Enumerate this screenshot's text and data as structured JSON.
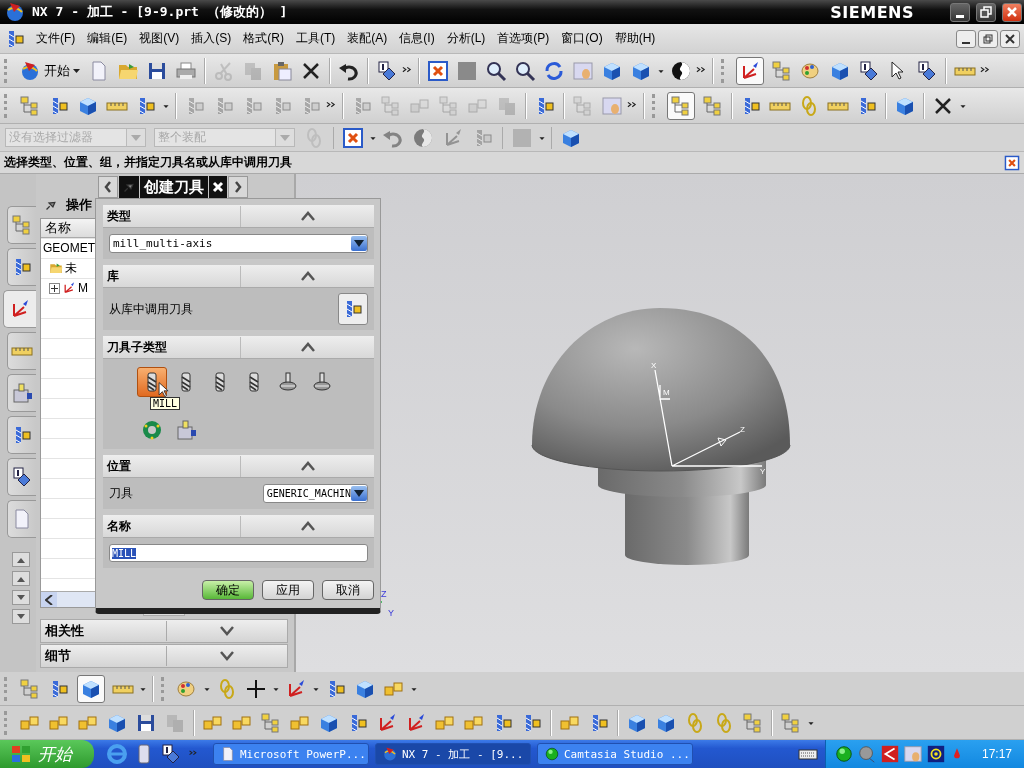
{
  "window": {
    "title": "NX 7 - 加工 - [9-9.prt （修改的） ]",
    "brand": "SIEMENS"
  },
  "menu": [
    "文件(F)",
    "编辑(E)",
    "视图(V)",
    "插入(S)",
    "格式(R)",
    "工具(T)",
    "装配(A)",
    "信息(I)",
    "分析(L)",
    "首选项(P)",
    "窗口(O)",
    "帮助(H)"
  ],
  "start_button": "开始",
  "filters": [
    {
      "value": "没有选择过滤器",
      "disabled": true
    },
    {
      "value": "整个装配",
      "disabled": true
    }
  ],
  "cue_line": "选择类型、位置、组，并指定刀具名或从库中调用刀具",
  "resource_tabs": [
    {
      "selected": false
    },
    {
      "selected": false
    },
    {
      "selected": true
    },
    {
      "selected": false
    },
    {
      "selected": false
    },
    {
      "selected": false
    },
    {
      "selected": false
    },
    {
      "selected": false
    }
  ],
  "navigator": {
    "title": "操作",
    "columns": [
      "名称"
    ],
    "tree": [
      {
        "label": "GEOMET",
        "children": [
          {
            "label": "未"
          },
          {
            "label": "M",
            "expanded": false
          }
        ]
      }
    ],
    "panels": [
      {
        "label": "相关性",
        "expanded": false
      },
      {
        "label": "细节",
        "expanded": false
      }
    ]
  },
  "dialog": {
    "title": "创建刀具",
    "sections": [
      {
        "kind": "dropdown",
        "title": "类型",
        "expanded": true,
        "value": "mill_multi-axis"
      },
      {
        "kind": "library",
        "title": "库",
        "expanded": true,
        "label": "从库中调用刀具"
      },
      {
        "kind": "subtypes",
        "title": "刀具子类型",
        "expanded": true,
        "tooltip": "MILL",
        "items": [
          {
            "selected": true
          },
          {
            "selected": false
          },
          {
            "selected": false
          },
          {
            "selected": false
          },
          {
            "selected": false
          },
          {
            "selected": false
          },
          {
            "selected": false
          },
          {
            "selected": false
          }
        ]
      },
      {
        "kind": "field",
        "title": "位置",
        "expanded": true,
        "label": "刀具",
        "value": "GENERIC_MACHIN"
      },
      {
        "kind": "name",
        "title": "名称",
        "expanded": true,
        "value": "MILL",
        "text_selected": true
      }
    ],
    "buttons": [
      {
        "label": "确定",
        "default": true
      },
      {
        "label": "应用",
        "default": false
      },
      {
        "label": "取消",
        "default": false
      }
    ]
  },
  "model_axes": [
    "X",
    "M",
    "Z",
    "Y"
  ],
  "view_triad": [
    "Z",
    "Y"
  ],
  "taskbar": {
    "start": "开始",
    "tasks": [
      {
        "label": "Microsoft PowerP...",
        "selected": false
      },
      {
        "label": "NX 7 - 加工 - [9...",
        "selected": true
      },
      {
        "label": "Camtasia Studio ...",
        "selected": false
      }
    ],
    "clock": "17:17"
  }
}
